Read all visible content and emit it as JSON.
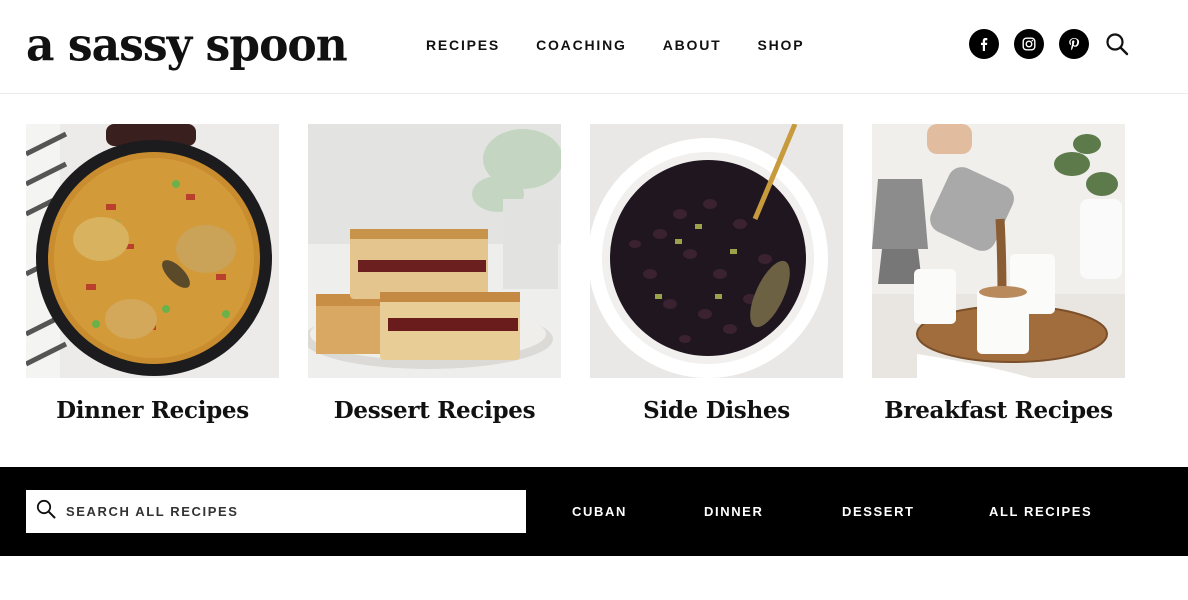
{
  "site": {
    "logo_text": "a sassy spoon"
  },
  "nav": {
    "items": [
      {
        "label": "RECIPES"
      },
      {
        "label": "COACHING"
      },
      {
        "label": "ABOUT"
      },
      {
        "label": "SHOP"
      }
    ]
  },
  "social": {
    "icons": [
      "facebook-icon",
      "instagram-icon",
      "pinterest-icon",
      "search-icon"
    ]
  },
  "categories": [
    {
      "title": "Dinner Recipes",
      "image": "paella-skillet"
    },
    {
      "title": "Dessert Recipes",
      "image": "guava-cake-bars"
    },
    {
      "title": "Side Dishes",
      "image": "black-beans-bowl"
    },
    {
      "title": "Breakfast Recipes",
      "image": "coffee-pour"
    }
  ],
  "bottom_bar": {
    "search_placeholder": "SEARCH ALL RECIPES",
    "links": [
      {
        "label": "CUBAN"
      },
      {
        "label": "DINNER"
      },
      {
        "label": "DESSERT"
      },
      {
        "label": "ALL RECIPES"
      }
    ]
  },
  "colors": {
    "bar_background": "#000000",
    "text": "#111111",
    "background": "#ffffff"
  }
}
